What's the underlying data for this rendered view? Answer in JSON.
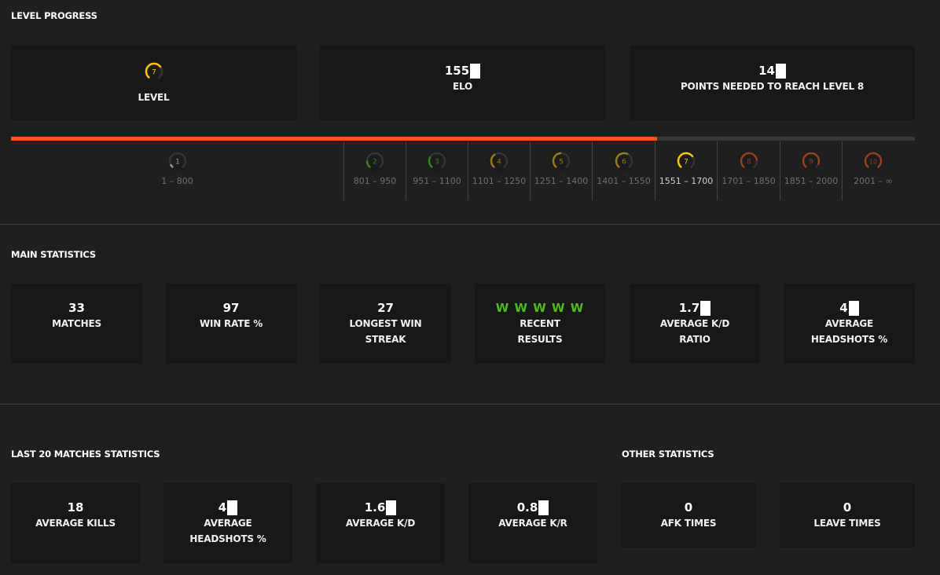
{
  "level_progress": {
    "title": "LEVEL PROGRESS",
    "cards": [
      {
        "value": "7",
        "label": "LEVEL"
      },
      {
        "value": "155",
        "redacted": true,
        "label": "ELO"
      },
      {
        "value": "14",
        "redacted": true,
        "label": "POINTS NEEDED TO REACH LEVEL 8"
      }
    ],
    "progress_percent": 71.5,
    "current_level": 7,
    "levels": [
      {
        "level": "1",
        "range": "1 – 800",
        "color": "#bbbbbb"
      },
      {
        "level": "2",
        "range": "801 – 950",
        "color": "#3e9a1e"
      },
      {
        "level": "3",
        "range": "951 – 1100",
        "color": "#3e9a1e"
      },
      {
        "level": "4",
        "range": "1101 – 1250",
        "color": "#b5941a"
      },
      {
        "level": "5",
        "range": "1251 – 1400",
        "color": "#b5941a"
      },
      {
        "level": "6",
        "range": "1401 – 1550",
        "color": "#b5941a"
      },
      {
        "level": "7",
        "range": "1551 – 1700",
        "color": "#fcc500"
      },
      {
        "level": "8",
        "range": "1701 – 1850",
        "color": "#b8421b"
      },
      {
        "level": "9",
        "range": "1851 – 2000",
        "color": "#b8421b"
      },
      {
        "level": "10",
        "range": "2001 – ∞",
        "color": "#b8421b"
      }
    ]
  },
  "main_statistics": {
    "title": "MAIN STATISTICS",
    "cards": [
      {
        "value": "33",
        "label": "MATCHES"
      },
      {
        "value": "97",
        "label": "WIN RATE %"
      },
      {
        "value": "27",
        "label": "LONGEST WIN STREAK"
      },
      {
        "value": "W W W W W",
        "label": "RECENT RESULTS"
      },
      {
        "value": "1.7",
        "redacted": true,
        "label": "AVERAGE K/D RATIO"
      },
      {
        "value": "4",
        "redacted": true,
        "label": "AVERAGE HEADSHOTS %"
      }
    ]
  },
  "last20": {
    "title": "LAST 20 MATCHES STATISTICS",
    "cards": [
      {
        "value": "18",
        "label": "AVERAGE KILLS"
      },
      {
        "value": "4",
        "redacted": true,
        "label": "AVERAGE HEADSHOTS %"
      },
      {
        "value": "1.6",
        "redacted": true,
        "label": "AVERAGE K/D"
      },
      {
        "value": "0.8",
        "redacted": true,
        "label": "AVERAGE K/R"
      }
    ]
  },
  "other": {
    "title": "OTHER STATISTICS",
    "cards": [
      {
        "value": "0",
        "label": "AFK TIMES"
      },
      {
        "value": "0",
        "label": "LEAVE TIMES"
      }
    ]
  },
  "colors": {
    "accent": "#ff5500",
    "win": "#4fbb20",
    "background": "#1f1f1f",
    "card": "#181818"
  }
}
